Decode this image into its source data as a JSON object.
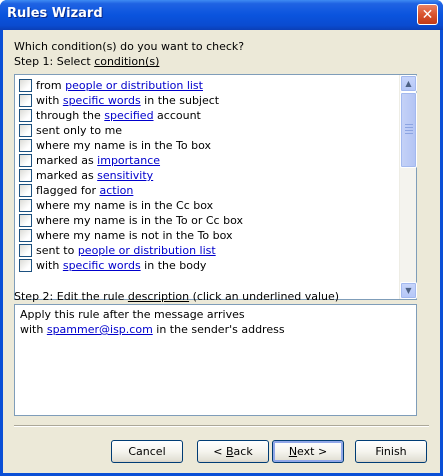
{
  "window": {
    "title": "Rules Wizard",
    "close_glyph": "✕"
  },
  "prompt": "Which condition(s) do you want to check?",
  "step1": {
    "prefix": "Step 1: Select ",
    "underlined": "condition(s)"
  },
  "conditions": [
    {
      "pre": "from ",
      "link": "people or distribution list",
      "post": ""
    },
    {
      "pre": "with ",
      "link": "specific words",
      "post": " in the subject"
    },
    {
      "pre": "through the ",
      "link": "specified",
      "post": " account"
    },
    {
      "pre": "sent only to me",
      "link": "",
      "post": ""
    },
    {
      "pre": "where my name is in the To box",
      "link": "",
      "post": ""
    },
    {
      "pre": "marked as ",
      "link": "importance",
      "post": ""
    },
    {
      "pre": "marked as ",
      "link": "sensitivity",
      "post": ""
    },
    {
      "pre": "flagged for ",
      "link": "action",
      "post": ""
    },
    {
      "pre": "where my name is in the Cc box",
      "link": "",
      "post": ""
    },
    {
      "pre": "where my name is in the To or Cc box",
      "link": "",
      "post": ""
    },
    {
      "pre": "where my name is not in the To box",
      "link": "",
      "post": ""
    },
    {
      "pre": "sent to ",
      "link": "people or distribution list",
      "post": ""
    },
    {
      "pre": "with ",
      "link": "specific words",
      "post": " in the body"
    }
  ],
  "step2": {
    "prefix": "Step 2: Edit the rule ",
    "underlined": "description",
    "suffix": " (click an underlined value)"
  },
  "description": {
    "line1": "Apply this rule after the message arrives",
    "line2_pre": "with ",
    "line2_link": "spammer@isp.com",
    "line2_post": " in the sender's address"
  },
  "buttons": {
    "cancel": "Cancel",
    "back_prefix": "< ",
    "back_access": "B",
    "back_rest": "ack",
    "next_access": "N",
    "next_rest": "ext >",
    "finish": "Finish"
  },
  "colors": {
    "link": "#0000cc",
    "title_bar": "#0a54de",
    "dialog_bg": "#ece9d8"
  }
}
